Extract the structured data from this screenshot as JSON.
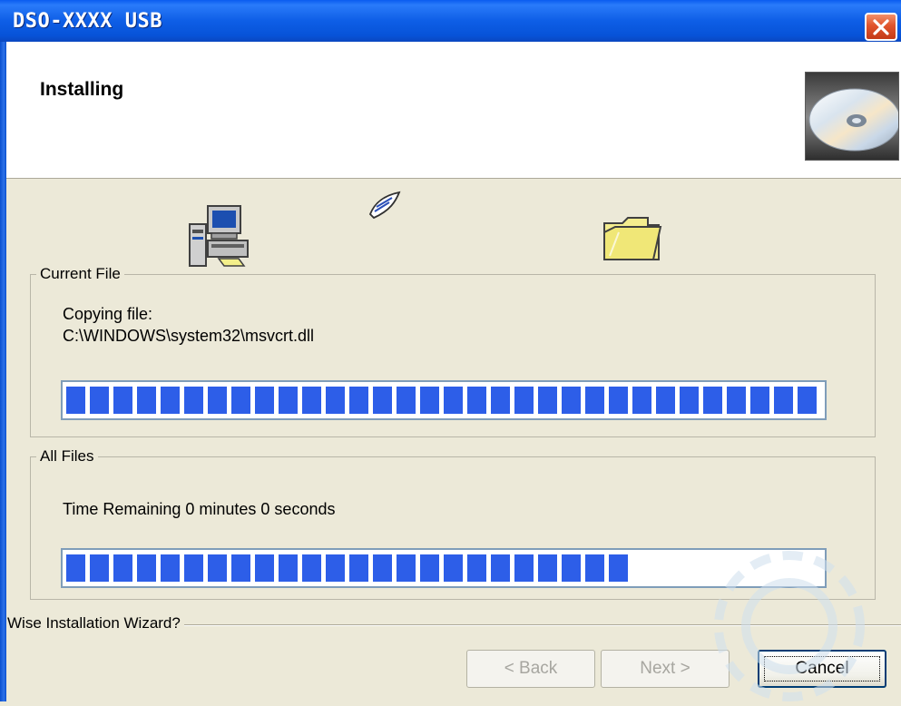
{
  "window": {
    "title": "DSO-XXXX USB"
  },
  "header": {
    "title": "Installing"
  },
  "current_file": {
    "legend": "Current File",
    "status_line1": "Copying file:",
    "status_line2": "C:\\WINDOWS\\system32\\msvcrt.dll",
    "progress": 1.0
  },
  "all_files": {
    "legend": "All Files",
    "time_remaining": "Time Remaining 0 minutes 0 seconds",
    "progress": 0.75
  },
  "footer": {
    "brand": "Wise Installation Wizard?"
  },
  "buttons": {
    "back": "< Back",
    "next": "Next >",
    "cancel": "Cancel"
  },
  "icons": [
    "computer-icon",
    "paper-icon",
    "folder-icon",
    "cd-icon",
    "close-icon"
  ],
  "colors": {
    "titlebar": "#0a5cf0",
    "progress_block": "#2d5ee8",
    "dialog_bg": "#ece9d8"
  }
}
